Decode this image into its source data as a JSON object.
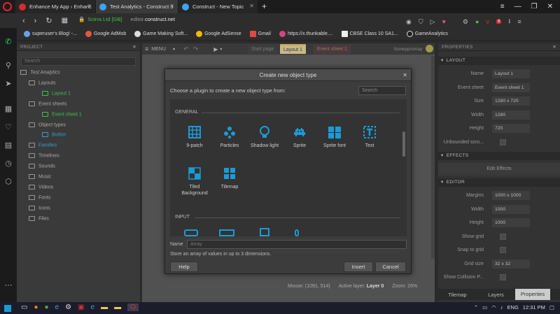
{
  "browser": {
    "tabs": [
      {
        "title": "Enhance My App › Enhanc",
        "active": false,
        "fav": "#e0272b"
      },
      {
        "title": "Test Analytics - Construct 3",
        "active": true,
        "fav": "#3aa6f0"
      },
      {
        "title": "Construct - New Topic",
        "active": false,
        "fav": "#3aa6f0"
      }
    ],
    "new_tab": "+",
    "security_label": "Scirra Ltd [GB]",
    "url_domain": "editor.",
    "url_host": "construct.net",
    "bookmarks": [
      "superuser's Blog! -...",
      "Google AdMob",
      "Game Making Soft...",
      "Google AdSense",
      "Gmail",
      "https://x.thunkable....",
      "CBSE Class 10 SA1...",
      "GameAnalytics"
    ],
    "badge": "9"
  },
  "project": {
    "title": "PROJECT",
    "search_placeholder": "Search",
    "tree": [
      {
        "label": "Test Analytics",
        "depth": 0,
        "italic": true,
        "color": "#aaa"
      },
      {
        "label": "Layouts",
        "depth": 1,
        "color": "#aaa"
      },
      {
        "label": "Layout 1",
        "depth": 2,
        "color": "#3ec24a"
      },
      {
        "label": "Event sheets",
        "depth": 1,
        "color": "#aaa"
      },
      {
        "label": "Event sheet 1",
        "depth": 2,
        "color": "#3ec24a"
      },
      {
        "label": "Object types",
        "depth": 1,
        "color": "#aaa"
      },
      {
        "label": "Button",
        "depth": 2,
        "color": "#3a9ad9"
      },
      {
        "label": "Families",
        "depth": 1,
        "color": "#3a9ad9"
      },
      {
        "label": "Timelines",
        "depth": 1,
        "color": "#aaa"
      },
      {
        "label": "Sounds",
        "depth": 1,
        "color": "#aaa"
      },
      {
        "label": "Music",
        "depth": 1,
        "color": "#aaa"
      },
      {
        "label": "Videos",
        "depth": 1,
        "color": "#aaa"
      },
      {
        "label": "Fonts",
        "depth": 1,
        "color": "#aaa"
      },
      {
        "label": "Icons",
        "depth": 1,
        "color": "#aaa"
      },
      {
        "label": "Files",
        "depth": 1,
        "color": "#aaa"
      }
    ]
  },
  "editor": {
    "menu_label": "MENU",
    "tabs": [
      "Start page",
      "Layout 1",
      "Event sheet 1"
    ],
    "user": "itsmeypromay",
    "status_mouse": "Mouse: (1091, 514)",
    "status_layer_label": "Active layer:",
    "status_layer": "Layer 0",
    "status_zoom": "Zoom: 26%"
  },
  "dialog": {
    "title": "Create new object type",
    "prompt": "Choose a plugin to create a new object type from:",
    "search_placeholder": "Search",
    "section_general": "GENERAL",
    "section_input": "INPUT",
    "plugins": [
      {
        "label": "9-patch",
        "icon": "nine-patch-icon"
      },
      {
        "label": "Particles",
        "icon": "particles-icon"
      },
      {
        "label": "Shadow light",
        "icon": "shadow-light-icon"
      },
      {
        "label": "Sprite",
        "icon": "sprite-icon"
      },
      {
        "label": "Sprite font",
        "icon": "sprite-font-icon"
      },
      {
        "label": "Text",
        "icon": "text-icon"
      },
      {
        "label": "Tiled Background",
        "icon": "tiled-background-icon"
      },
      {
        "label": "Tilemap",
        "icon": "tilemap-icon"
      }
    ],
    "name_label": "Name",
    "name_placeholder": "Array",
    "description": "Store an array of values in up to 3 dimensions.",
    "help": "Help",
    "insert": "Insert",
    "cancel": "Cancel"
  },
  "properties": {
    "title": "PROPERTIES",
    "sec_layout": "LAYOUT",
    "sec_effects": "EFFECTS",
    "sec_editor": "EDITOR",
    "layout_rows": [
      {
        "label": "Name",
        "value": "Layout 1"
      },
      {
        "label": "Event sheet",
        "value": "Event sheet 1"
      },
      {
        "label": "Size",
        "value": "1280 x 720"
      },
      {
        "label": "Width",
        "value": "1280"
      },
      {
        "label": "Height",
        "value": "720"
      },
      {
        "label": "Unbounded scro...",
        "value": ""
      }
    ],
    "edit_effects": "Edit Effects",
    "editor_rows": [
      {
        "label": "Margins",
        "value": "1000 x 1000"
      },
      {
        "label": "Width",
        "value": "1000"
      },
      {
        "label": "Height",
        "value": "1000"
      },
      {
        "label": "Show grid",
        "value": ""
      },
      {
        "label": "Snap to grid",
        "value": ""
      },
      {
        "label": "Grid size",
        "value": "32 x 32"
      },
      {
        "label": "Show Collision P...",
        "value": ""
      }
    ],
    "bottom_tabs": [
      "Tilemap",
      "Layers",
      "Properties"
    ]
  },
  "taskbar": {
    "time": "12:31 PM",
    "lang": "ENG"
  },
  "colors": {
    "accent": "#1b9bd6",
    "green": "#3ec24a",
    "blue": "#3a9ad9"
  }
}
